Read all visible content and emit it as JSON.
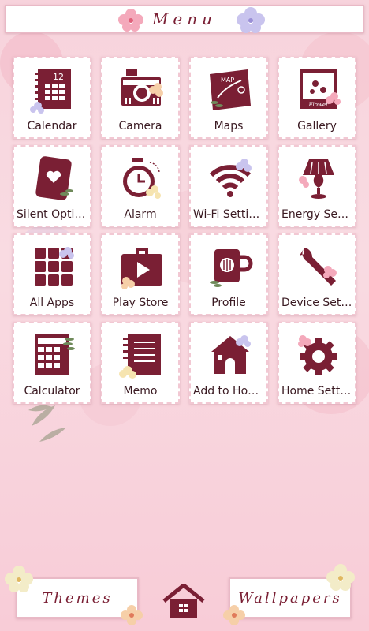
{
  "header": {
    "title": "Menu"
  },
  "grid": [
    {
      "label": "Calendar",
      "icon": "calendar-icon"
    },
    {
      "label": "Camera",
      "icon": "camera-icon"
    },
    {
      "label": "Maps",
      "icon": "map-icon"
    },
    {
      "label": "Gallery",
      "icon": "gallery-icon"
    },
    {
      "label": "Silent Options",
      "icon": "silent-icon"
    },
    {
      "label": "Alarm",
      "icon": "alarm-icon"
    },
    {
      "label": "Wi-Fi Settings",
      "icon": "wifi-icon"
    },
    {
      "label": "Energy Setti…",
      "icon": "lamp-icon"
    },
    {
      "label": "All Apps",
      "icon": "all-apps-icon"
    },
    {
      "label": "Play Store",
      "icon": "play-store-icon"
    },
    {
      "label": "Profile",
      "icon": "profile-cup-icon"
    },
    {
      "label": "Device Setti…",
      "icon": "wrench-icon"
    },
    {
      "label": "Calculator",
      "icon": "calculator-icon"
    },
    {
      "label": "Memo",
      "icon": "memo-icon"
    },
    {
      "label": "Add to Home",
      "icon": "house-icon"
    },
    {
      "label": "Home Setti…",
      "icon": "gear-icon"
    }
  ],
  "calendar_icon_text": "12",
  "map_icon_text": "MAP",
  "gallery_icon_text": "Flower",
  "bottom": {
    "themes": "Themes",
    "wallpapers": "Wallpapers"
  },
  "colors": {
    "icon": "#7a1f34",
    "accent": "#e9b9c6",
    "background": "#f8d6de"
  }
}
